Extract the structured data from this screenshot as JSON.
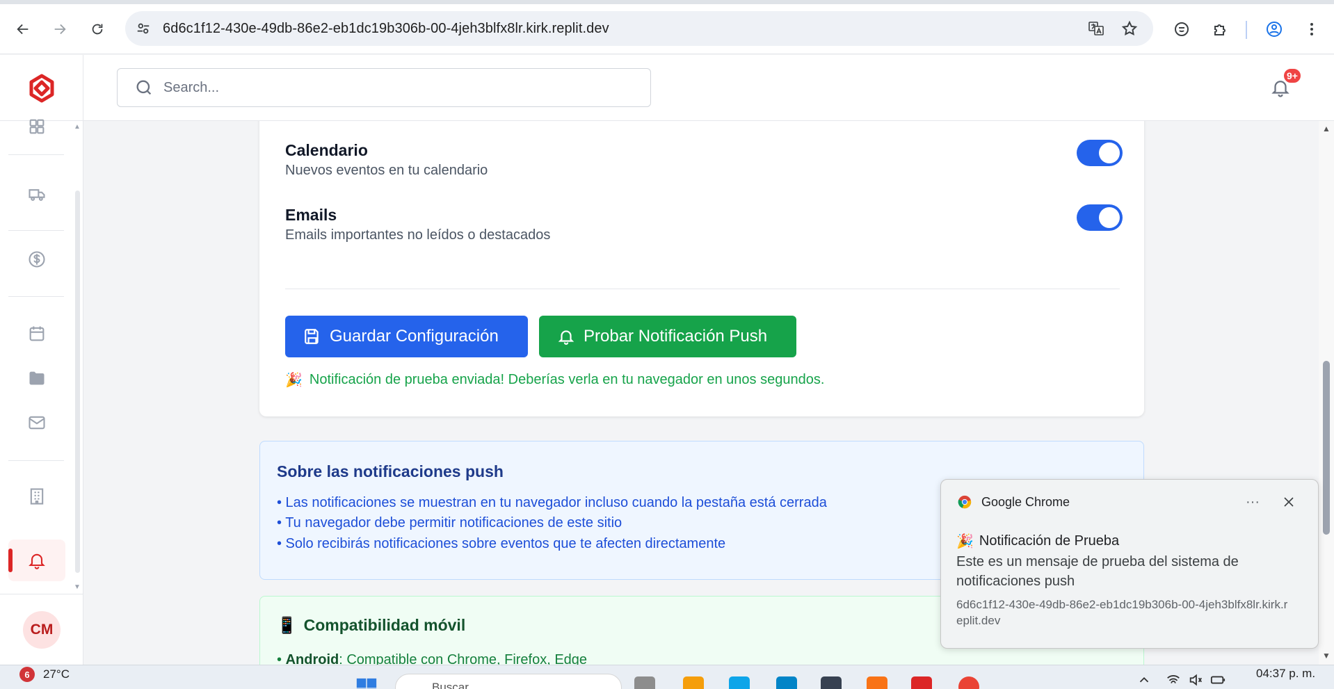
{
  "browser": {
    "url": "6d6c1f12-430e-49db-86e2-eb1dc19b306b-00-4jeh3blfx8lr.kirk.replit.dev",
    "back_icon": "arrow-left-icon",
    "forward_icon": "arrow-right-icon",
    "reload_icon": "reload-icon",
    "translate_icon": "translate-icon",
    "bookmark_icon": "star-icon",
    "extension_icons": [
      "shield-extension-icon",
      "puzzle-icon"
    ],
    "profile_icon": "profile-icon",
    "menu_icon": "kebab-menu-icon"
  },
  "header": {
    "search_placeholder": "Search...",
    "notification_badge": "9+"
  },
  "sidebar": {
    "items": [
      "dashboard-icon",
      "truck-icon",
      "dollar-icon",
      "calendar-icon",
      "folder-icon",
      "mail-icon",
      "building-icon",
      "bell-icon"
    ],
    "active_item": "bell-icon",
    "avatar_initials": "CM",
    "active_color": "#dc2626"
  },
  "settings": {
    "prefs": [
      {
        "title": "Calendario",
        "description": "Nuevos eventos en tu calendario",
        "enabled": true
      },
      {
        "title": "Emails",
        "description": "Emails importantes no leídos o destacados",
        "enabled": true
      }
    ],
    "save_label": "Guardar Configuración",
    "test_label": "Probar Notificación Push",
    "success_emoji": "🎉",
    "success_message": "Notificación de prueba enviada! Deberías verla en tu navegador en unos segundos.",
    "toggle_color": "#2563eb",
    "save_color": "#2563eb",
    "test_color": "#16a34a"
  },
  "info": {
    "title": "Sobre las notificaciones push",
    "items": [
      "• Las notificaciones se muestran en tu navegador incluso cuando la pestaña está cerrada",
      "• Tu navegador debe permitir notificaciones de este sitio",
      "• Solo recibirás notificaciones sobre eventos que te afecten directamente"
    ]
  },
  "mobile": {
    "emoji": "📱",
    "title": "Compatibilidad móvil",
    "item_bullet": "• ",
    "item_label": "Android",
    "item_text": ": Compatible con Chrome, Firefox, Edge"
  },
  "toast": {
    "app_name": "Google Chrome",
    "more_label": "···",
    "title_emoji": "🎉",
    "title": "Notificación de Prueba",
    "body": "Este es un mensaje de prueba del sistema de notificaciones push",
    "origin": "6d6c1f12-430e-49db-86e2-eb1dc19b306b-00-4jeh3blfx8lr.kirk.replit.dev"
  },
  "taskbar": {
    "weather_badge": "6",
    "temperature": "27°C",
    "search_placeholder": "Buscar",
    "time": "04:37 p. m."
  }
}
